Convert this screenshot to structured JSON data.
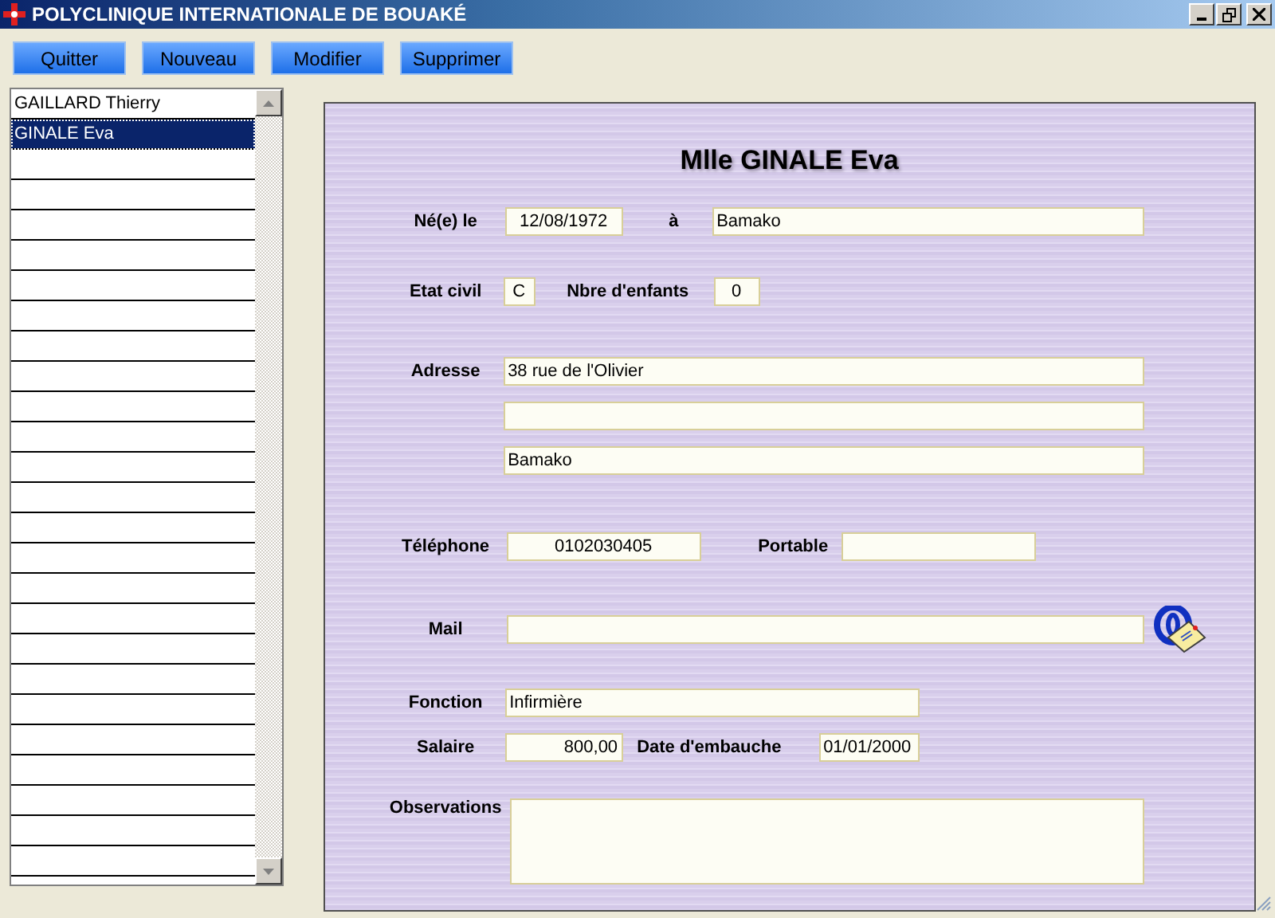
{
  "window": {
    "title": "POLYCLINIQUE INTERNATIONALE DE BOUAKÉ"
  },
  "toolbar": {
    "buttons": [
      "Quitter",
      "Nouveau",
      "Modifier",
      "Supprimer"
    ]
  },
  "patient_list": {
    "items": [
      {
        "label": "GAILLARD Thierry",
        "selected": false
      },
      {
        "label": "GINALE Eva",
        "selected": true
      }
    ]
  },
  "form": {
    "title": "Mlle GINALE Eva",
    "birth_date": {
      "label": "Né(e) le",
      "value": "12/08/1972"
    },
    "birth_place": {
      "label": "à",
      "value": "Bamako"
    },
    "civil_status": {
      "label": "Etat civil",
      "value": "C"
    },
    "children": {
      "label": "Nbre d'enfants",
      "value": "0"
    },
    "address": {
      "label": "Adresse",
      "street": "38 rue de l'Olivier",
      "city": "Bamako"
    },
    "phone": {
      "label": "Téléphone",
      "value": "0102030405"
    },
    "mobile": {
      "label": "Portable"
    },
    "mail": {
      "label": "Mail"
    },
    "function": {
      "label": "Fonction",
      "value": "Infirmière"
    },
    "salary": {
      "label": "Salaire",
      "value": "800,00"
    },
    "hire_date": {
      "label": "Date d'embauche",
      "value": "01/01/2000"
    },
    "observations": {
      "label": "Observations"
    }
  }
}
